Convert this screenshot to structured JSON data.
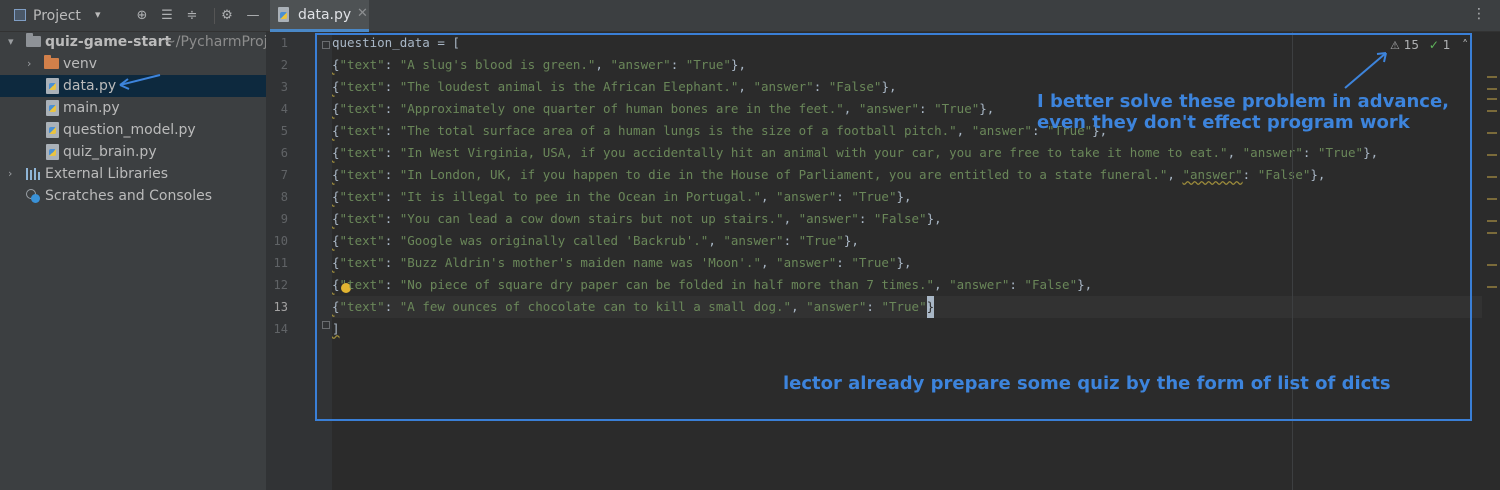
{
  "project_panel": {
    "title": "Project",
    "root": {
      "name": "quiz-game-start",
      "path": "~/PycharmProj"
    },
    "items": [
      {
        "label": "venv"
      },
      {
        "label": "data.py"
      },
      {
        "label": "main.py"
      },
      {
        "label": "question_model.py"
      },
      {
        "label": "quiz_brain.py"
      },
      {
        "label": "External Libraries"
      },
      {
        "label": "Scratches and Consoles"
      }
    ]
  },
  "editor": {
    "tab_label": "data.py",
    "line_numbers": [
      "1",
      "2",
      "3",
      "4",
      "5",
      "6",
      "7",
      "8",
      "9",
      "10",
      "11",
      "12",
      "13",
      "14"
    ],
    "header": "question_data = [",
    "closing": "]",
    "entries": [
      {
        "text": "A slug's blood is green.",
        "answer": "True"
      },
      {
        "text": "The loudest animal is the African Elephant.",
        "answer": "False"
      },
      {
        "text": "Approximately one quarter of human bones are in the feet.",
        "answer": "True"
      },
      {
        "text": "The total surface area of a human lungs is the size of a football pitch.",
        "answer": "True"
      },
      {
        "text": "In West Virginia, USA, if you accidentally hit an animal with your car, you are free to take it home to eat.",
        "answer": "True"
      },
      {
        "text": "In London, UK, if you happen to die in the House of Parliament, you are entitled to a state funeral.",
        "answer": "False"
      },
      {
        "text": "It is illegal to pee in the Ocean in Portugal.",
        "answer": "True"
      },
      {
        "text": "You can lead a cow down stairs but not up stairs.",
        "answer": "False"
      },
      {
        "text": "Google was originally called 'Backrub'.",
        "answer": "True"
      },
      {
        "text": "Buzz Aldrin's mother's maiden name was 'Moon'.",
        "answer": "True"
      },
      {
        "text": "No piece of square dry paper can be folded in half more than 7 times.",
        "answer": "False"
      },
      {
        "text": "A few ounces of chocolate can to kill a small dog.",
        "answer": "True"
      }
    ],
    "warnings_count": "15",
    "ok_count": "1"
  },
  "annotations": {
    "advice_line1": "I better solve these problem in advance,",
    "advice_line2": "even they don't effect program work",
    "quiz_note": "lector already prepare some quiz by the form of list of dicts"
  },
  "colors": {
    "annotation": "#3d84dc",
    "string": "#6a8759",
    "selection": "#0d293e"
  }
}
